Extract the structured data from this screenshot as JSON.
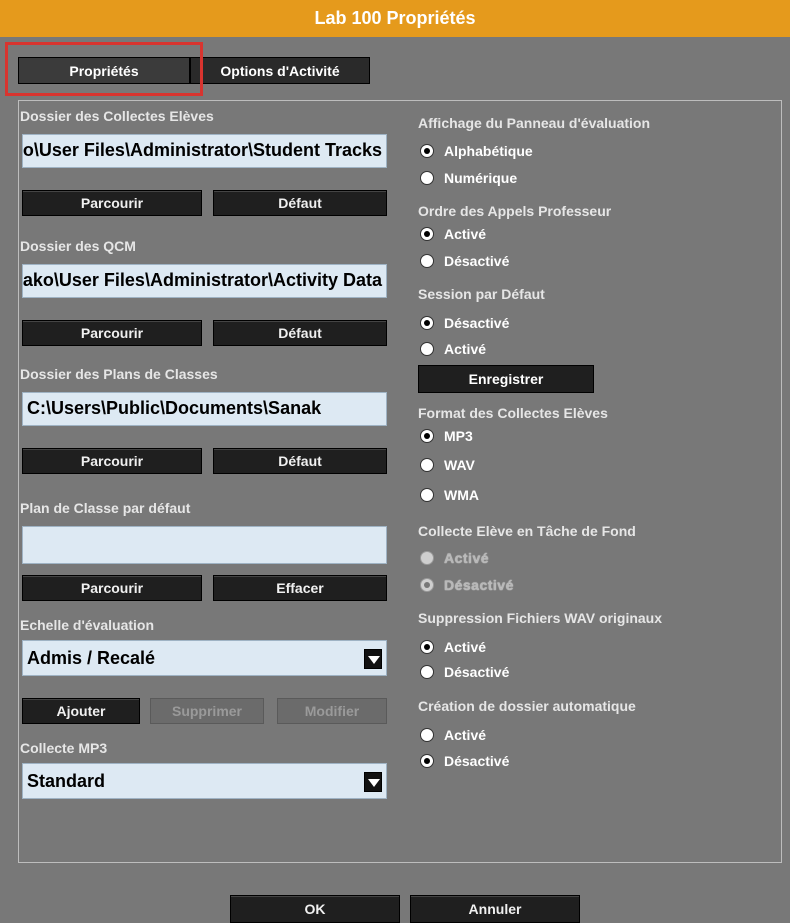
{
  "window": {
    "title": "Lab 100 Propriétés"
  },
  "tabs": [
    {
      "label": "Propriétés",
      "active": true
    },
    {
      "label": "Options d'Activité",
      "active": false
    }
  ],
  "left": {
    "collectes": {
      "label": "Dossier des Collectes Elèves",
      "value": "C:\\Users\\Public\\Documents\\Sanako\\User Files\\Administrator\\Student Tracks",
      "browse": "Parcourir",
      "default": "Défaut"
    },
    "qcm": {
      "label": "Dossier des QCM",
      "value": "C:\\Users\\Public\\Documents\\Sanako\\User Files\\Administrator\\Activity Data",
      "browse": "Parcourir",
      "default": "Défaut"
    },
    "plans": {
      "label": "Dossier des Plans de Classes",
      "value": "C:\\Users\\Public\\Documents\\Sanak",
      "browse": "Parcourir",
      "default": "Défaut"
    },
    "plan_defaut": {
      "label": "Plan de Classe par défaut",
      "value": "",
      "browse": "Parcourir",
      "clear": "Effacer"
    },
    "echelle": {
      "label": "Echelle d'évaluation",
      "selected": "Admis / Recalé",
      "add": "Ajouter",
      "remove": "Supprimer",
      "edit": "Modifier"
    },
    "mp3": {
      "label": "Collecte MP3",
      "selected": "Standard"
    }
  },
  "right": {
    "affichage": {
      "label": "Affichage du Panneau d'évaluation",
      "options": [
        {
          "label": "Alphabétique",
          "checked": true
        },
        {
          "label": "Numérique",
          "checked": false
        }
      ]
    },
    "ordre": {
      "label": "Ordre des Appels Professeur",
      "options": [
        {
          "label": "Activé",
          "checked": true
        },
        {
          "label": "Désactivé",
          "checked": false
        }
      ]
    },
    "session": {
      "label": "Session par Défaut",
      "options": [
        {
          "label": "Désactivé",
          "checked": true
        },
        {
          "label": "Activé",
          "checked": false
        }
      ],
      "save": "Enregistrer"
    },
    "format": {
      "label": "Format des Collectes Elèves",
      "options": [
        {
          "label": "MP3",
          "checked": true
        },
        {
          "label": "WAV",
          "checked": false
        },
        {
          "label": "WMA",
          "checked": false
        }
      ]
    },
    "fond": {
      "label": "Collecte Elève en Tâche de Fond",
      "options": [
        {
          "label": "Activé",
          "checked": false
        },
        {
          "label": "Désactivé",
          "checked": true
        }
      ]
    },
    "suppression": {
      "label": "Suppression Fichiers WAV originaux",
      "options": [
        {
          "label": "Activé",
          "checked": true
        },
        {
          "label": "Désactivé",
          "checked": false
        }
      ]
    },
    "creation": {
      "label": "Création de dossier automatique",
      "options": [
        {
          "label": "Activé",
          "checked": false
        },
        {
          "label": "Désactivé",
          "checked": true
        }
      ]
    }
  },
  "footer": {
    "ok": "OK",
    "cancel": "Annuler"
  },
  "colors": {
    "title_bar": "#e59a1c",
    "background": "#787878",
    "highlight": "#d8342f",
    "field": "#dde9f3"
  }
}
